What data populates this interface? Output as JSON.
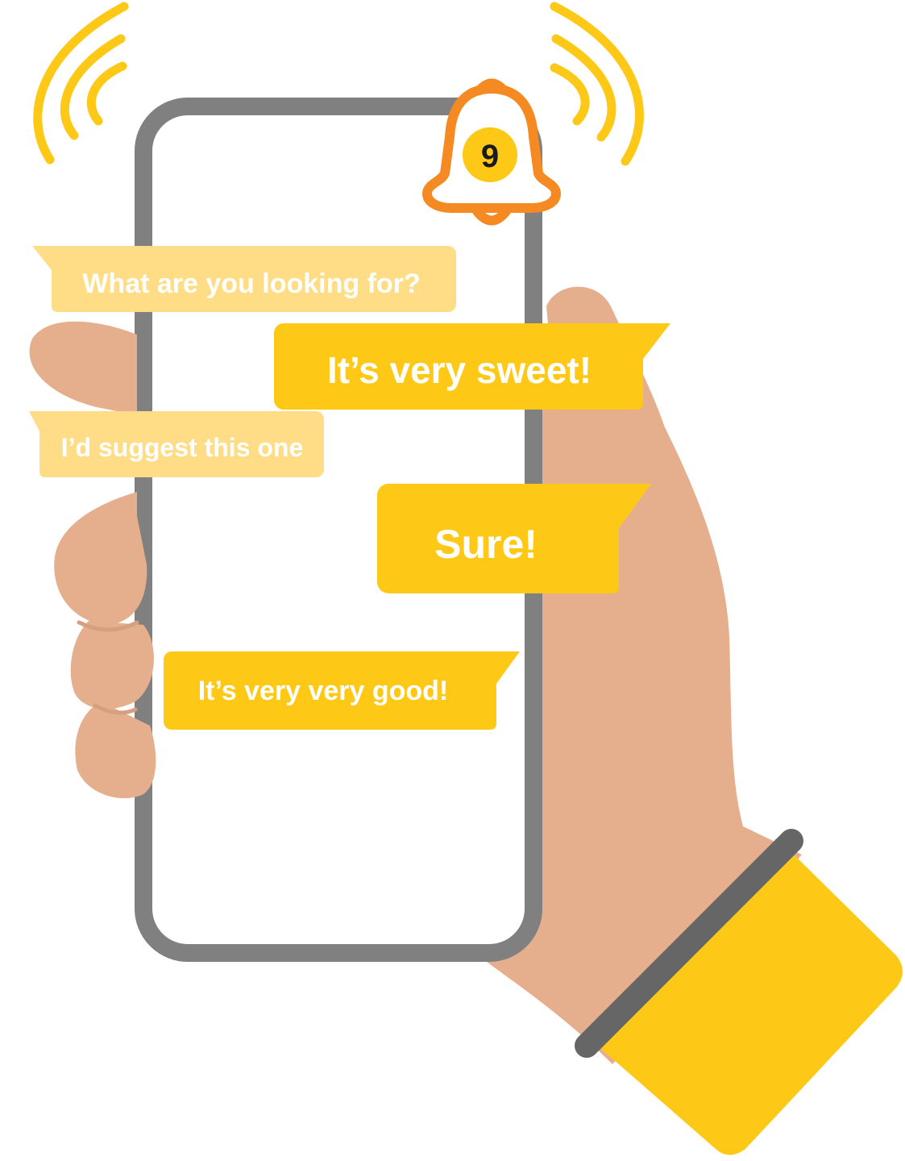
{
  "colors": {
    "accent_yellow": "#FDC816",
    "light_yellow": "#FEDD86",
    "bell_orange": "#F48A21",
    "skin": "#E5AF8E",
    "phone_frame": "#808080",
    "wristband": "#666666",
    "white": "#FFFFFF"
  },
  "notification": {
    "icon": "bell-icon",
    "count": "9"
  },
  "messages": [
    {
      "text": "What are you looking for?",
      "style": "light"
    },
    {
      "text": "It’s very sweet!",
      "style": "accent"
    },
    {
      "text": "I’d suggest this one",
      "style": "light"
    },
    {
      "text": "Sure!",
      "style": "accent"
    },
    {
      "text": "It’s very very good!",
      "style": "accent"
    }
  ]
}
